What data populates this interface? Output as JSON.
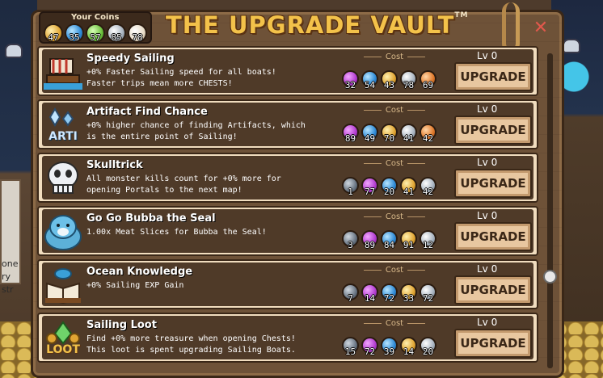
{
  "header": {
    "title": "THE UPGRADE VAULT",
    "trademark": "TM",
    "coins_label": "Your Coins",
    "coins": [
      {
        "color": "#e0a533",
        "icon": "gold-coin-icon",
        "value": "47"
      },
      {
        "color": "#2f8bd6",
        "icon": "blue-coin-icon",
        "value": "35"
      },
      {
        "color": "#6cc13d",
        "icon": "green-coin-icon",
        "value": "57"
      },
      {
        "color": "#a9b4c0",
        "icon": "silver-coin-icon",
        "value": "85"
      },
      {
        "color": "#e8dcc8",
        "icon": "pale-coin-icon",
        "value": "78"
      }
    ]
  },
  "close_label": "✕",
  "upgrades": [
    {
      "name": "Speedy Sailing",
      "icon": "sailing-ship-icon",
      "desc1": "+0% Faster Sailing speed for all boats!",
      "desc2": "Faster trips mean more CHESTS!",
      "cost_label": "Cost",
      "costs": [
        {
          "coin": "purple",
          "value": "32"
        },
        {
          "coin": "blue",
          "value": "54"
        },
        {
          "coin": "gold",
          "value": "43"
        },
        {
          "coin": "silver",
          "value": "78"
        },
        {
          "coin": "orange",
          "value": "69"
        }
      ],
      "level": "Lv 0",
      "button": "UPGRADE"
    },
    {
      "name": "Artifact Find Chance",
      "icon": "artifact-crystal-icon",
      "icon_text": "ARTI",
      "desc1": "+0% higher chance of finding Artifacts, which",
      "desc2": "is the entire point of Sailing!",
      "cost_label": "Cost",
      "costs": [
        {
          "coin": "purple",
          "value": "89"
        },
        {
          "coin": "blue",
          "value": "49"
        },
        {
          "coin": "gold",
          "value": "70"
        },
        {
          "coin": "silver",
          "value": "41"
        },
        {
          "coin": "orange",
          "value": "42"
        }
      ],
      "level": "Lv 0",
      "button": "UPGRADE"
    },
    {
      "name": "Skulltrick",
      "icon": "skull-icon",
      "desc1": "All monster kills count for +0% more for",
      "desc2": "opening Portals to the next map!",
      "cost_label": "Cost",
      "costs": [
        {
          "coin": "dark",
          "value": "1"
        },
        {
          "coin": "purple",
          "value": "77"
        },
        {
          "coin": "blue",
          "value": "20"
        },
        {
          "coin": "gold",
          "value": "41"
        },
        {
          "coin": "silver",
          "value": "42"
        }
      ],
      "level": "Lv 0",
      "button": "UPGRADE"
    },
    {
      "name": "Go Go Bubba the Seal",
      "icon": "seal-icon",
      "desc1": "1.00x Meat Slices for Bubba the Seal!",
      "desc2": "",
      "cost_label": "Cost",
      "costs": [
        {
          "coin": "dark",
          "value": "3"
        },
        {
          "coin": "purple",
          "value": "89"
        },
        {
          "coin": "blue",
          "value": "84"
        },
        {
          "coin": "gold",
          "value": "91"
        },
        {
          "coin": "silver",
          "value": "12"
        }
      ],
      "level": "Lv 0",
      "button": "UPGRADE"
    },
    {
      "name": "Ocean Knowledge",
      "icon": "open-book-icon",
      "desc1": "+0% Sailing EXP Gain",
      "desc2": "",
      "cost_label": "Cost",
      "costs": [
        {
          "coin": "dark",
          "value": "7"
        },
        {
          "coin": "purple",
          "value": "14"
        },
        {
          "coin": "blue",
          "value": "72"
        },
        {
          "coin": "gold",
          "value": "33"
        },
        {
          "coin": "silver",
          "value": "72"
        }
      ],
      "level": "Lv 0",
      "button": "UPGRADE"
    },
    {
      "name": "Sailing Loot",
      "icon": "loot-treasure-icon",
      "icon_text": "LOOT",
      "desc1": "Find +0% more treasure when opening Chests!",
      "desc2": "This loot is spent upgrading Sailing Boats.",
      "cost_label": "Cost",
      "costs": [
        {
          "coin": "dark",
          "value": "15"
        },
        {
          "coin": "purple",
          "value": "72"
        },
        {
          "coin": "blue",
          "value": "39"
        },
        {
          "coin": "gold",
          "value": "14"
        },
        {
          "coin": "silver",
          "value": "20"
        }
      ],
      "level": "Lv 0",
      "button": "UPGRADE"
    }
  ],
  "background": {
    "poster_lines": [
      "one",
      "ry",
      "str"
    ]
  }
}
